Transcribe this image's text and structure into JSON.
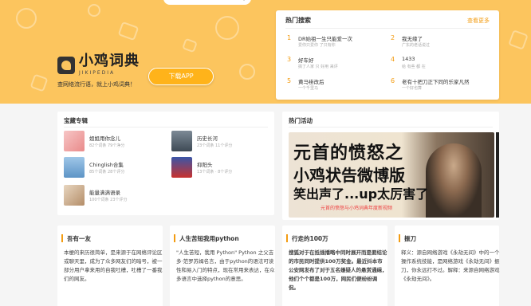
{
  "brand": {
    "name_cn": "小鸡词典",
    "name_en": "JIKIPEDIA",
    "slogan": "查网络流行语，就上小鸡词典！",
    "download_label": "下载APP"
  },
  "hot_search": {
    "title": "热门搜索",
    "more_label": "查看更多",
    "items": [
      {
        "num": "1",
        "title": "DR始祖一生只能爱一次",
        "sub": "爱你只爱你 了只有你"
      },
      {
        "num": "2",
        "title": "我无缘了",
        "sub": "广东的老话说过"
      },
      {
        "num": "3",
        "title": "好车好",
        "sub": "搞了人家 只 好用 来评"
      },
      {
        "num": "4",
        "title": "1433",
        "sub": "给 有些 都 在"
      },
      {
        "num": "5",
        "title": "黄马褂改后",
        "sub": "一个千里马"
      },
      {
        "num": "6",
        "title": "老有十把刀正下同的乐家凡然",
        "sub": "一个好也算"
      }
    ]
  },
  "albums": {
    "title": "宝藏专辑",
    "items": [
      {
        "title": "姐姐用你念儿",
        "sub": "82个词条 79个净分"
      },
      {
        "title": "历史长河",
        "sub": "23个词条 11个评分"
      },
      {
        "title": "Chinglish合集",
        "sub": "85个词条 28个评分"
      },
      {
        "title": "抑阳头",
        "sub": "13个词条 · 8个评分"
      },
      {
        "title": "能量满满语录",
        "sub": "100个词条 23个评分"
      }
    ]
  },
  "activity": {
    "title": "热门活动",
    "banner_line1": "元首的愤怒之",
    "banner_line2": "小鸡状告微博版",
    "banner_line3": "笑出声了...up太厉害了",
    "banner_sub": "元首的愤怒与小鸡词典年度新视频"
  },
  "articles": [
    {
      "title": "吾有一友",
      "body": "本梗的来历很简单，是来源于在网络评论区或聊天里，成为了众多网友们的暗号，被一部分用户拿来用的自我吐槽，吐槽了一番我们的网友。"
    },
    {
      "title": "人生苦短我用python",
      "body": "\"人生苦短，我用 Python\" Python 之父吉多·范罗苏姆名言，由于python的语法可读性和易入门的特点，现在常用来表达，在众多语言中选择python的意思。"
    },
    {
      "title": "行走的100万",
      "body": "搜狐对于在抵插播略中同时展开而是要结论的市民同时提供100万奖金。最近抖本市公安网发布了对于五名嫌疑人的悬赏通缉，他们个个都是100万，网民们便纷纷调侃。"
    },
    {
      "title": "振刀",
      "body": "释义：源自网络游戏《永劫无间》中的一个操作系统技能，是网络游戏《永劫无间》振刀，你永远打不过。解释：来源自网络游戏《永劫无间》。"
    }
  ]
}
